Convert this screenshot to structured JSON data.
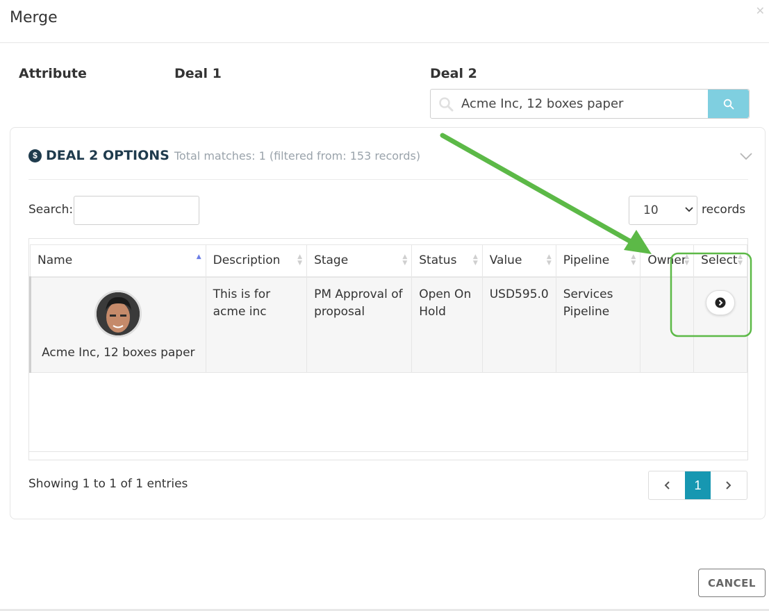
{
  "modal": {
    "title": "Merge",
    "close_icon": "close-icon"
  },
  "columns": {
    "attribute": "Attribute",
    "deal1": "Deal 1",
    "deal2": "Deal 2"
  },
  "deal2_search": {
    "value": "Acme Inc, 12 boxes paper",
    "search_icon": "search-icon",
    "button_icon": "search-icon",
    "button_color": "#7fcfe0"
  },
  "options_panel": {
    "icon": "dollar-icon",
    "title": "DEAL 2 OPTIONS",
    "subtitle": "Total matches: 1 (filtered from: 153 records)",
    "collapse_icon": "chevron-down-icon",
    "search_label": "Search:",
    "search_value": "",
    "records_select_value": "10",
    "records_label": "records"
  },
  "table": {
    "headers": [
      "Name",
      "Description",
      "Stage",
      "Status",
      "Value",
      "Pipeline",
      "Owner",
      "Select"
    ],
    "rows": [
      {
        "name": "Acme Inc, 12 boxes paper",
        "description": "This is for acme inc",
        "stage": "PM Approval of proposal",
        "status": "Open On Hold",
        "value": "USD595.0",
        "pipeline": "Services Pipeline",
        "owner": "",
        "select_icon": "chevron-right-circle-icon"
      }
    ]
  },
  "footer": {
    "showing": "Showing 1 to 1 of 1 entries",
    "prev_icon": "chevron-left-icon",
    "current_page": "1",
    "next_icon": "chevron-right-icon",
    "accent": "#1797b1"
  },
  "actions": {
    "cancel_label": "CANCEL"
  },
  "annotation": {
    "arrow_color": "#5cb947"
  }
}
